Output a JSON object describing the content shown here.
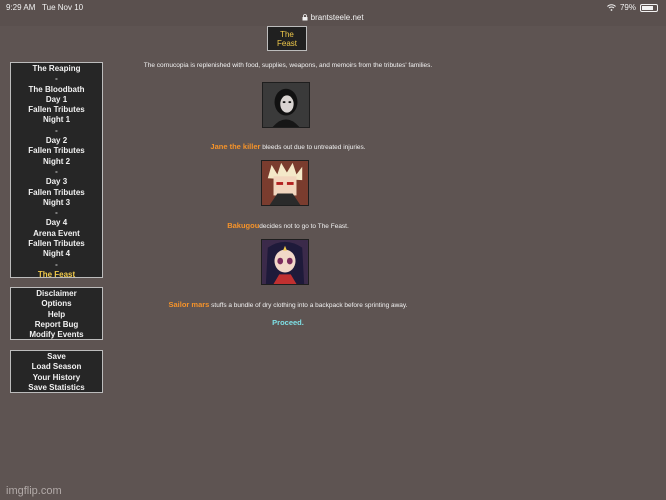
{
  "status_bar": {
    "time": "9:29 AM",
    "date": "Tue Nov 10",
    "url": "brantsteele.net",
    "battery": "79%",
    "battery_level": 0.79,
    "icons": [
      "wifi-icon",
      "battery-icon",
      "lock-icon"
    ]
  },
  "feast_tab": {
    "line1": "The",
    "line2": "Feast"
  },
  "menu_main": {
    "items": [
      {
        "label": "The Reaping",
        "type": "link"
      },
      {
        "label": "-",
        "type": "sep"
      },
      {
        "label": "The Bloodbath",
        "type": "link"
      },
      {
        "label": "Day 1",
        "type": "link"
      },
      {
        "label": "Fallen Tributes",
        "type": "link"
      },
      {
        "label": "Night 1",
        "type": "link"
      },
      {
        "label": "-",
        "type": "sep"
      },
      {
        "label": "Day 2",
        "type": "link"
      },
      {
        "label": "Fallen Tributes",
        "type": "link"
      },
      {
        "label": "Night 2",
        "type": "link"
      },
      {
        "label": "-",
        "type": "sep"
      },
      {
        "label": "Day 3",
        "type": "link"
      },
      {
        "label": "Fallen Tributes",
        "type": "link"
      },
      {
        "label": "Night 3",
        "type": "link"
      },
      {
        "label": "-",
        "type": "sep"
      },
      {
        "label": "Day 4",
        "type": "link"
      },
      {
        "label": "Arena Event",
        "type": "link"
      },
      {
        "label": "Fallen Tributes",
        "type": "link"
      },
      {
        "label": "Night 4",
        "type": "link"
      },
      {
        "label": "-",
        "type": "sep"
      },
      {
        "label": "The Feast",
        "type": "active"
      }
    ]
  },
  "menu_info": {
    "items": [
      "Disclaimer",
      "Options",
      "Help",
      "Report Bug",
      "Modify Events"
    ]
  },
  "menu_save": {
    "items": [
      "Save",
      "Load Season",
      "Your History",
      "Save Statistics"
    ]
  },
  "content": {
    "intro": "The cornucopia is replenished with food, supplies, weapons, and memoirs from the tributes' families.",
    "events": [
      {
        "name": "Jane the killer",
        "text": " bleeds out due to untreated injuries."
      },
      {
        "name": "Bakugou",
        "text": "decides not to go to The Feast."
      },
      {
        "name": "Sailor mars",
        "text": " stuffs a bundle of dry clothing into a backpack before sprinting away."
      }
    ],
    "proceed": "Proceed."
  },
  "watermark": "imgflip.com",
  "colors": {
    "background": "#5e5452",
    "menu_bg": "#262626",
    "active": "#f0c94a",
    "tribute_name": "#f5932a",
    "proceed": "#7ee0e6"
  }
}
